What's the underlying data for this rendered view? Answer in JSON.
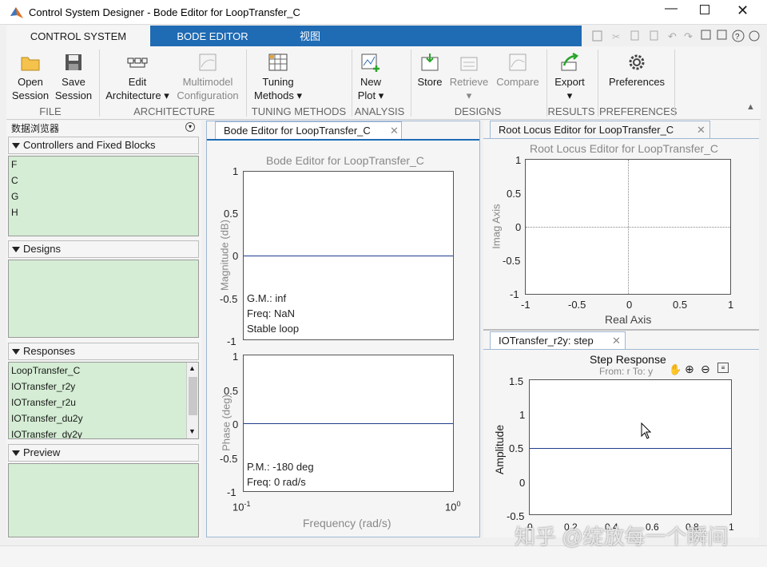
{
  "window": {
    "title": "Control System Designer - Bode Editor for LoopTransfer_C"
  },
  "tabs": {
    "control_system": "CONTROL SYSTEM",
    "bode_editor": "BODE EDITOR",
    "view": "视图"
  },
  "ribbon": {
    "open_l1": "Open",
    "open_l2": "Session",
    "save_l1": "Save",
    "save_l2": "Session",
    "edit_arch_l1": "Edit",
    "edit_arch_l2": "Architecture",
    "multimodel_l1": "Multimodel",
    "multimodel_l2": "Configuration",
    "tuning_l1": "Tuning",
    "tuning_l2": "Methods",
    "newplot_l1": "New",
    "newplot_l2": "Plot",
    "store": "Store",
    "retrieve": "Retrieve",
    "compare": "Compare",
    "export": "Export",
    "preferences": "Preferences",
    "groups": {
      "file": "FILE",
      "architecture": "ARCHITECTURE",
      "tuning": "TUNING METHODS",
      "analysis": "ANALYSIS",
      "designs": "DESIGNS",
      "results": "RESULTS",
      "preferences": "PREFERENCES"
    }
  },
  "browser": {
    "title": "数据浏览器",
    "controllers_title": "Controllers and Fixed Blocks",
    "controllers": [
      "F",
      "C",
      "G",
      "H"
    ],
    "designs_title": "Designs",
    "responses_title": "Responses",
    "responses": [
      "LoopTransfer_C",
      "IOTransfer_r2y",
      "IOTransfer_r2u",
      "IOTransfer_du2y",
      "IOTransfer_dy2y"
    ],
    "preview_title": "Preview"
  },
  "bode": {
    "tab": "Bode Editor for LoopTransfer_C",
    "title": "Bode Editor for LoopTransfer_C",
    "mag_ylabel": "Magnitude (dB)",
    "phase_ylabel": "Phase (deg)",
    "xlabel": "Frequency (rad/s)",
    "mag_yticks": [
      "1",
      "0.5",
      "0",
      "-0.5",
      "-1"
    ],
    "phase_yticks": [
      "1",
      "0.5",
      "0",
      "-0.5",
      "-1"
    ],
    "xtick_base1": "10",
    "xtick_exp1": "-1",
    "xtick_base2": "10",
    "xtick_exp2": "0",
    "gm": "G.M.: inf",
    "freq_nan": "Freq: NaN",
    "stable": "Stable loop",
    "pm": "P.M.: -180 deg",
    "freq0": "Freq: 0 rad/s"
  },
  "rlocus": {
    "tab": "Root Locus Editor for LoopTransfer_C",
    "title": "Root Locus Editor for LoopTransfer_C",
    "ylabel": "Imag Axis",
    "xlabel": "Real Axis",
    "yticks": [
      "1",
      "0.5",
      "0",
      "-0.5",
      "-1"
    ],
    "xticks": [
      "-1",
      "-0.5",
      "0",
      "0.5",
      "1"
    ]
  },
  "step": {
    "tab": "IOTransfer_r2y: step",
    "title": "Step Response",
    "subtitle": "From: r  To: y",
    "ylabel": "Amplitude",
    "yticks": [
      "1.5",
      "1",
      "0.5",
      "0",
      "-0.5"
    ],
    "xticks": [
      "0",
      "0.2",
      "0.4",
      "0.6",
      "0.8",
      "1"
    ]
  },
  "watermark": "知乎 @绽放每一个瞬间",
  "colors": {
    "accent": "#1f6bb4",
    "panel_green": "#d4edd4",
    "trace": "#1f3d8c"
  }
}
